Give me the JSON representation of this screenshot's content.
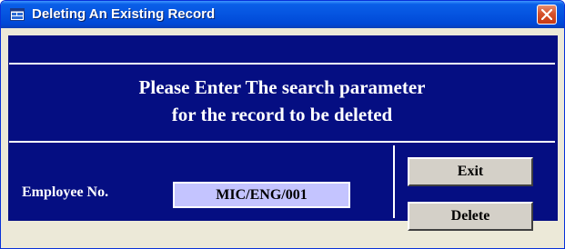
{
  "window": {
    "title": "Deleting An Existing Record",
    "close_icon": "close-icon",
    "app_icon": "form-icon"
  },
  "header": {
    "line1": "Please Enter The search parameter",
    "line2": "for the record to be deleted"
  },
  "form": {
    "employee_label": "Employee No.",
    "employee_value": "MIC/ENG/001"
  },
  "buttons": {
    "exit_label": "Exit",
    "delete_label": "Delete"
  },
  "colors": {
    "panel_bg": "#050e82",
    "field_bg": "#c4c4ff",
    "titlebar": "#0554e0",
    "close_button": "#d5512c"
  }
}
